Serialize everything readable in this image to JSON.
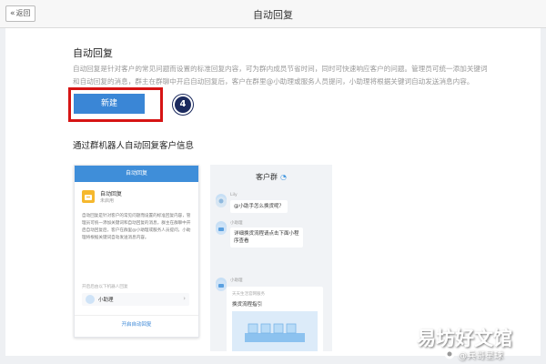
{
  "topbar": {
    "back_label": "返回",
    "title": "自动回复"
  },
  "section": {
    "title": "自动回复",
    "description_line1": "自动回复是针对客户的常见问题而设置的标准回复内容，可为群内成员节省时间，同时可快速响应客户的问题。管理员可统一添加关键词",
    "description_line2": "和自动回复的消息，群主在群聊中开启自动回复后，客户在群里@小助理或服务人员提问，小助理将根据关键词自动发送消息内容。",
    "new_button": "新建",
    "step_number": "4"
  },
  "subsection": {
    "heading": "通过群机器人自动回复客户信息"
  },
  "card_a": {
    "header": "自动回复",
    "name": "自动回复",
    "tag": "未启用",
    "text": "自动回复是针对客户的常见问题而设置的标准回复内容，管理员可统一添加关键词和自动回复的消息，群主在群聊中开启自动回复后，客户在群里@小助理或服务人员提问，小助理将根据关键词自动发送消息内容。",
    "hint": "开启后由以下机器人回复",
    "robot_name": "小助理",
    "link": "开启自动回复"
  },
  "card_b": {
    "title": "客户群",
    "user_name": "Lily",
    "user_message": "@小助手怎么换货呢？",
    "bot_name_1": "小助理",
    "bot_message_1": "详细换货流程请点击下面小程序查看",
    "bot_name_2": "小助理",
    "card_sub": "天天生活官网服务",
    "card_title": "换货流程指引"
  },
  "watermark": {
    "text": "易坊好文馆",
    "sub": "@兵哥星球"
  },
  "colors": {
    "accent": "#3a86d6",
    "highlight_frame": "#d61414",
    "badge": "#1b2a5e"
  }
}
